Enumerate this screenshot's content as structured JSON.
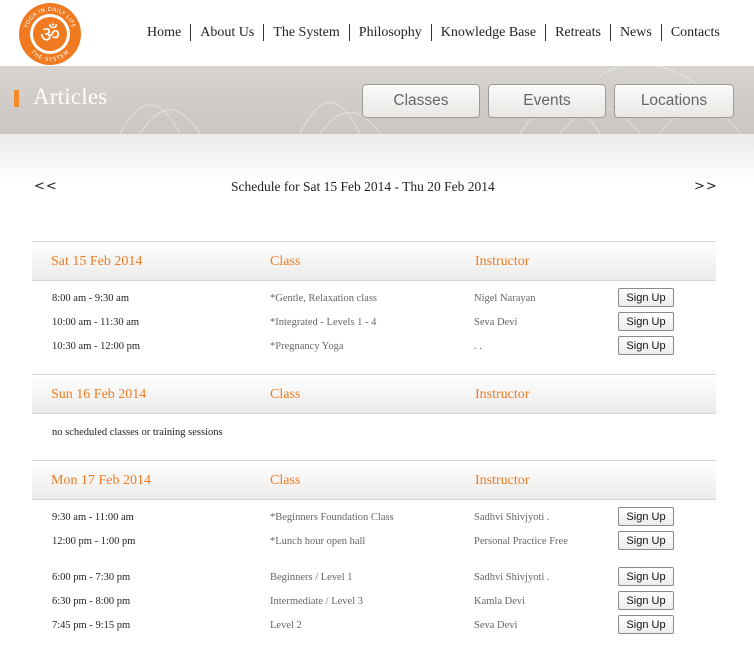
{
  "logo": {
    "text_top": "YOGA IN DAILY LIFE",
    "text_bottom": "THE SYSTEM",
    "color": "#f07a20"
  },
  "nav": {
    "items": [
      "Home",
      "About Us",
      "The System",
      "Philosophy",
      "Knowledge Base",
      "Retreats",
      "News",
      "Contacts"
    ]
  },
  "banner": {
    "title": "Articles",
    "buttons": [
      "Classes",
      "Events",
      "Locations"
    ],
    "accent": "#f28a2c"
  },
  "schedule": {
    "prev": "<<",
    "next": ">>",
    "title": "Schedule for Sat 15 Feb 2014 - Thu 20 Feb 2014"
  },
  "days": [
    {
      "date": "Sat 15 Feb 2014",
      "class_header": "Class",
      "instructor_header": "Instructor",
      "rows": [
        {
          "time": "8:00 am - 9:30 am",
          "class": "*Gentle, Relaxation class",
          "instructor": "Nigel Narayan",
          "button": "Sign Up"
        },
        {
          "time": "10:00 am - 11:30 am",
          "class": "*Integrated - Levels 1 - 4",
          "instructor": "Seva Devi",
          "button": "Sign Up"
        },
        {
          "time": "10:30 am - 12:00 pm",
          "class": "*Pregnancy Yoga",
          "instructor": ". .",
          "button": "Sign Up"
        }
      ]
    },
    {
      "date": "Sun 16 Feb 2014",
      "class_header": "Class",
      "instructor_header": "Instructor",
      "empty_message": "no scheduled classes or training sessions"
    },
    {
      "date": "Mon 17 Feb 2014",
      "class_header": "Class",
      "instructor_header": "Instructor",
      "rows": [
        {
          "time": "9:30 am - 11:00 am",
          "class": "*Beginners Foundation Class",
          "instructor": "Sadhvi Shivjyoti .",
          "button": "Sign Up"
        },
        {
          "time": "12:00 pm - 1:00 pm",
          "class": "*Lunch hour open hall",
          "instructor": "Personal Practice Free",
          "button": "Sign Up"
        },
        {
          "time": "6:00 pm - 7:30 pm",
          "class": "Beginners / Level 1",
          "instructor": "Sadhvi Shivjyoti .",
          "button": "Sign Up"
        },
        {
          "time": "6:30 pm - 8:00 pm",
          "class": "Intermediate / Level 3",
          "instructor": "Kamla Devi",
          "button": "Sign Up"
        },
        {
          "time": "7:45 pm - 9:15 pm",
          "class": "Level 2",
          "instructor": "Seva Devi",
          "button": "Sign Up"
        }
      ]
    }
  ]
}
